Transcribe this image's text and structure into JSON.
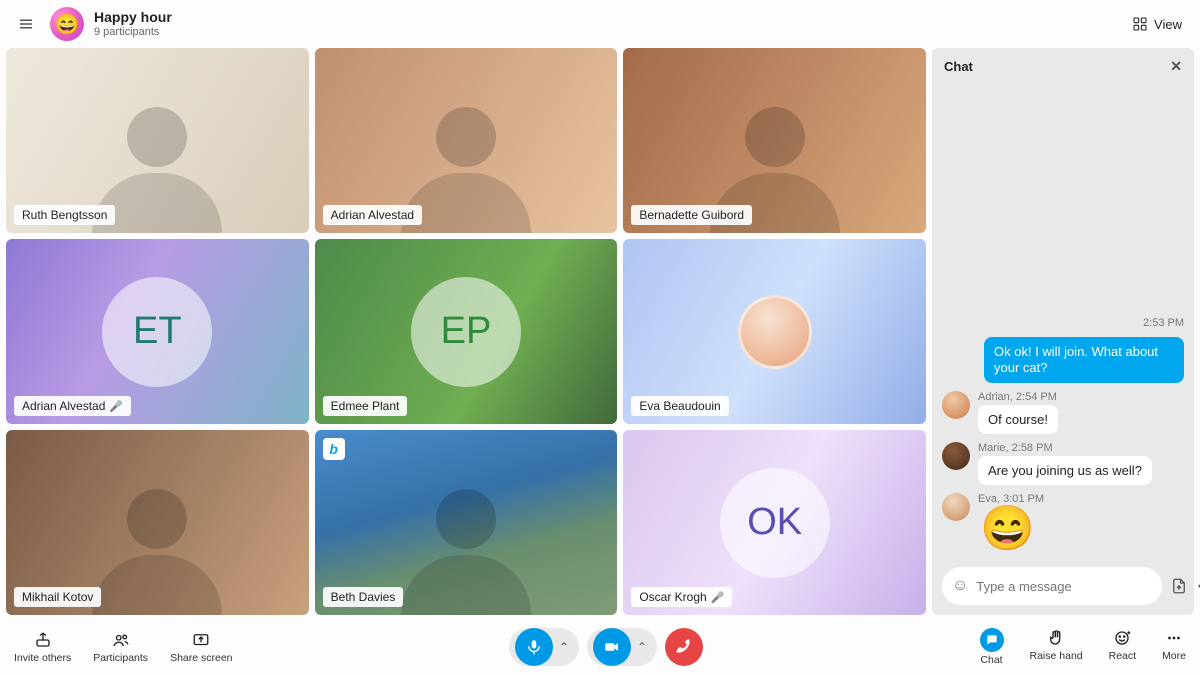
{
  "header": {
    "title": "Happy hour",
    "subtitle": "9 participants",
    "view_label": "View",
    "group_emoji": "😄"
  },
  "participants": [
    {
      "name": "Ruth Bengtsson",
      "muted": false
    },
    {
      "name": "Adrian Alvestad",
      "muted": false
    },
    {
      "name": "Bernadette Guibord",
      "muted": false
    },
    {
      "name": "Adrian Alvestad",
      "muted": true,
      "initials": "ET"
    },
    {
      "name": "Edmee Plant",
      "muted": false,
      "initials": "EP"
    },
    {
      "name": "Eva Beaudouin",
      "muted": false
    },
    {
      "name": "Mikhail Kotov",
      "muted": false
    },
    {
      "name": "Beth Davies",
      "muted": false,
      "badge": "b"
    },
    {
      "name": "Oscar Krogh",
      "muted": true,
      "initials": "OK"
    }
  ],
  "chat": {
    "title": "Chat",
    "timestamp_top": "2:53 PM",
    "self_message": "Ok ok! I will join. What about your cat?",
    "messages": [
      {
        "author": "Adrian",
        "time": "2:54 PM",
        "text": "Of course!"
      },
      {
        "author": "Marie",
        "time": "2:58 PM",
        "text": "Are you joining us as well?"
      },
      {
        "author": "Eva",
        "time": "3:01 PM",
        "emoji": "😄"
      }
    ],
    "input_placeholder": "Type a message"
  },
  "controls": {
    "left": [
      {
        "id": "invite",
        "label": "Invite others"
      },
      {
        "id": "participants",
        "label": "Participants"
      },
      {
        "id": "share",
        "label": "Share screen"
      }
    ],
    "right": [
      {
        "id": "chat",
        "label": "Chat",
        "active": true
      },
      {
        "id": "raise",
        "label": "Raise hand"
      },
      {
        "id": "react",
        "label": "React"
      },
      {
        "id": "more",
        "label": "More"
      }
    ]
  }
}
